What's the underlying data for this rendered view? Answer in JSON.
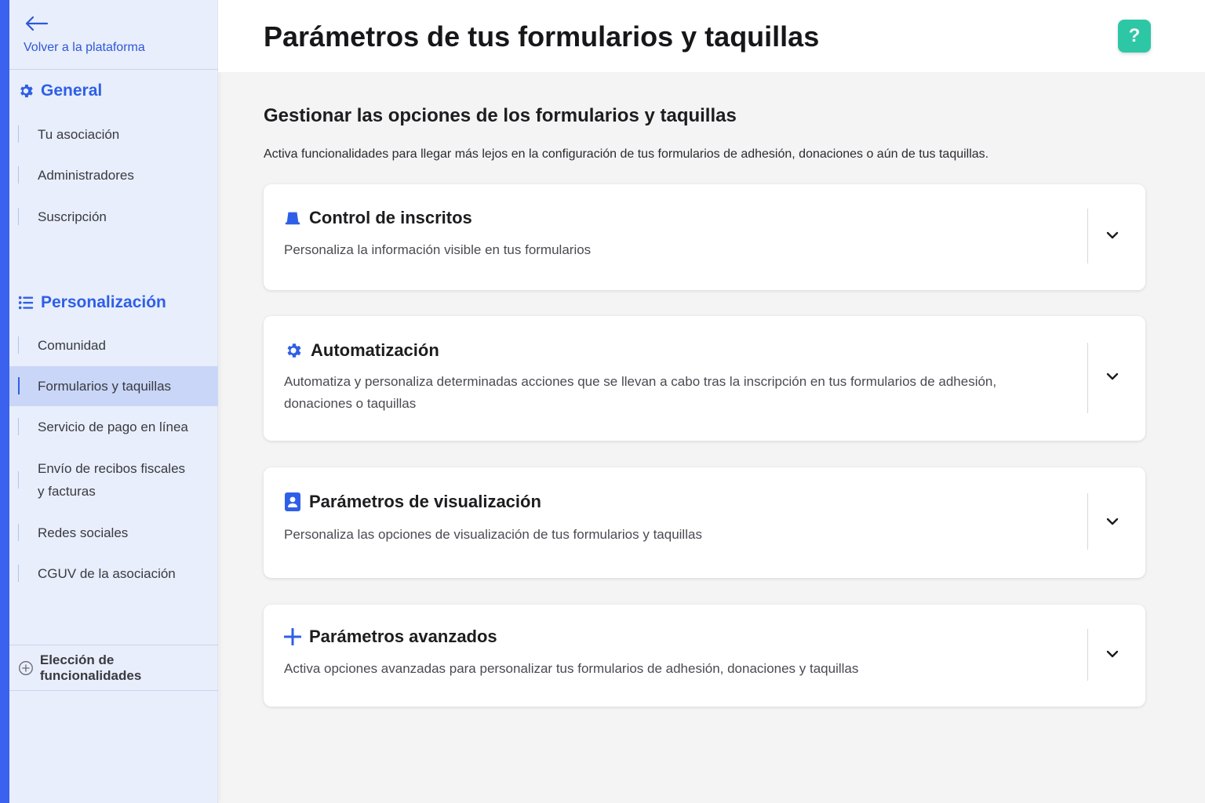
{
  "sidebar": {
    "back_label": "Volver a la plataforma",
    "general": {
      "title": "General",
      "items": [
        "Tu asociación",
        "Administradores",
        "Suscripción"
      ]
    },
    "personalizacion": {
      "title": "Personalización",
      "items": [
        "Comunidad",
        "Formularios y taquillas",
        "Servicio de pago en línea",
        "Envío de recibos fiscales y facturas",
        "Redes sociales",
        "CGUV de la asociación"
      ],
      "active": "Formularios y taquillas"
    },
    "features_label": "Elección de funcionalidades"
  },
  "header": {
    "title": "Parámetros de tus formularios y taquillas",
    "help_label": "?"
  },
  "main": {
    "heading": "Gestionar las opciones de los formularios y taquillas",
    "description": "Activa funcionalidades para llegar más lejos en la configuración de tus formularios de adhesión, donaciones o aún de tus taquillas.",
    "cards": [
      {
        "title": "Control de inscritos",
        "description": "Personaliza la información visible en tus formularios",
        "icon": "desk-bell-icon"
      },
      {
        "title": "Automatización",
        "description": "Automatiza y personaliza determinadas acciones que se llevan a cabo tras la inscripción en tus formularios de adhesión, donaciones o taquillas",
        "icon": "gear-icon"
      },
      {
        "title": "Parámetros de visualización",
        "description": "Personaliza las opciones de visualización de tus formularios y taquillas",
        "icon": "id-card-icon"
      },
      {
        "title": "Parámetros avanzados",
        "description": "Activa opciones avanzadas para personalizar tus formularios de adhesión, donaciones y taquillas",
        "icon": "plus-icon"
      }
    ]
  },
  "colors": {
    "accent": "#3b62ef",
    "sidebar_bg": "#e8eefb",
    "sidebar_active": "#c9d6f7",
    "help_button": "#2dc7a6"
  }
}
